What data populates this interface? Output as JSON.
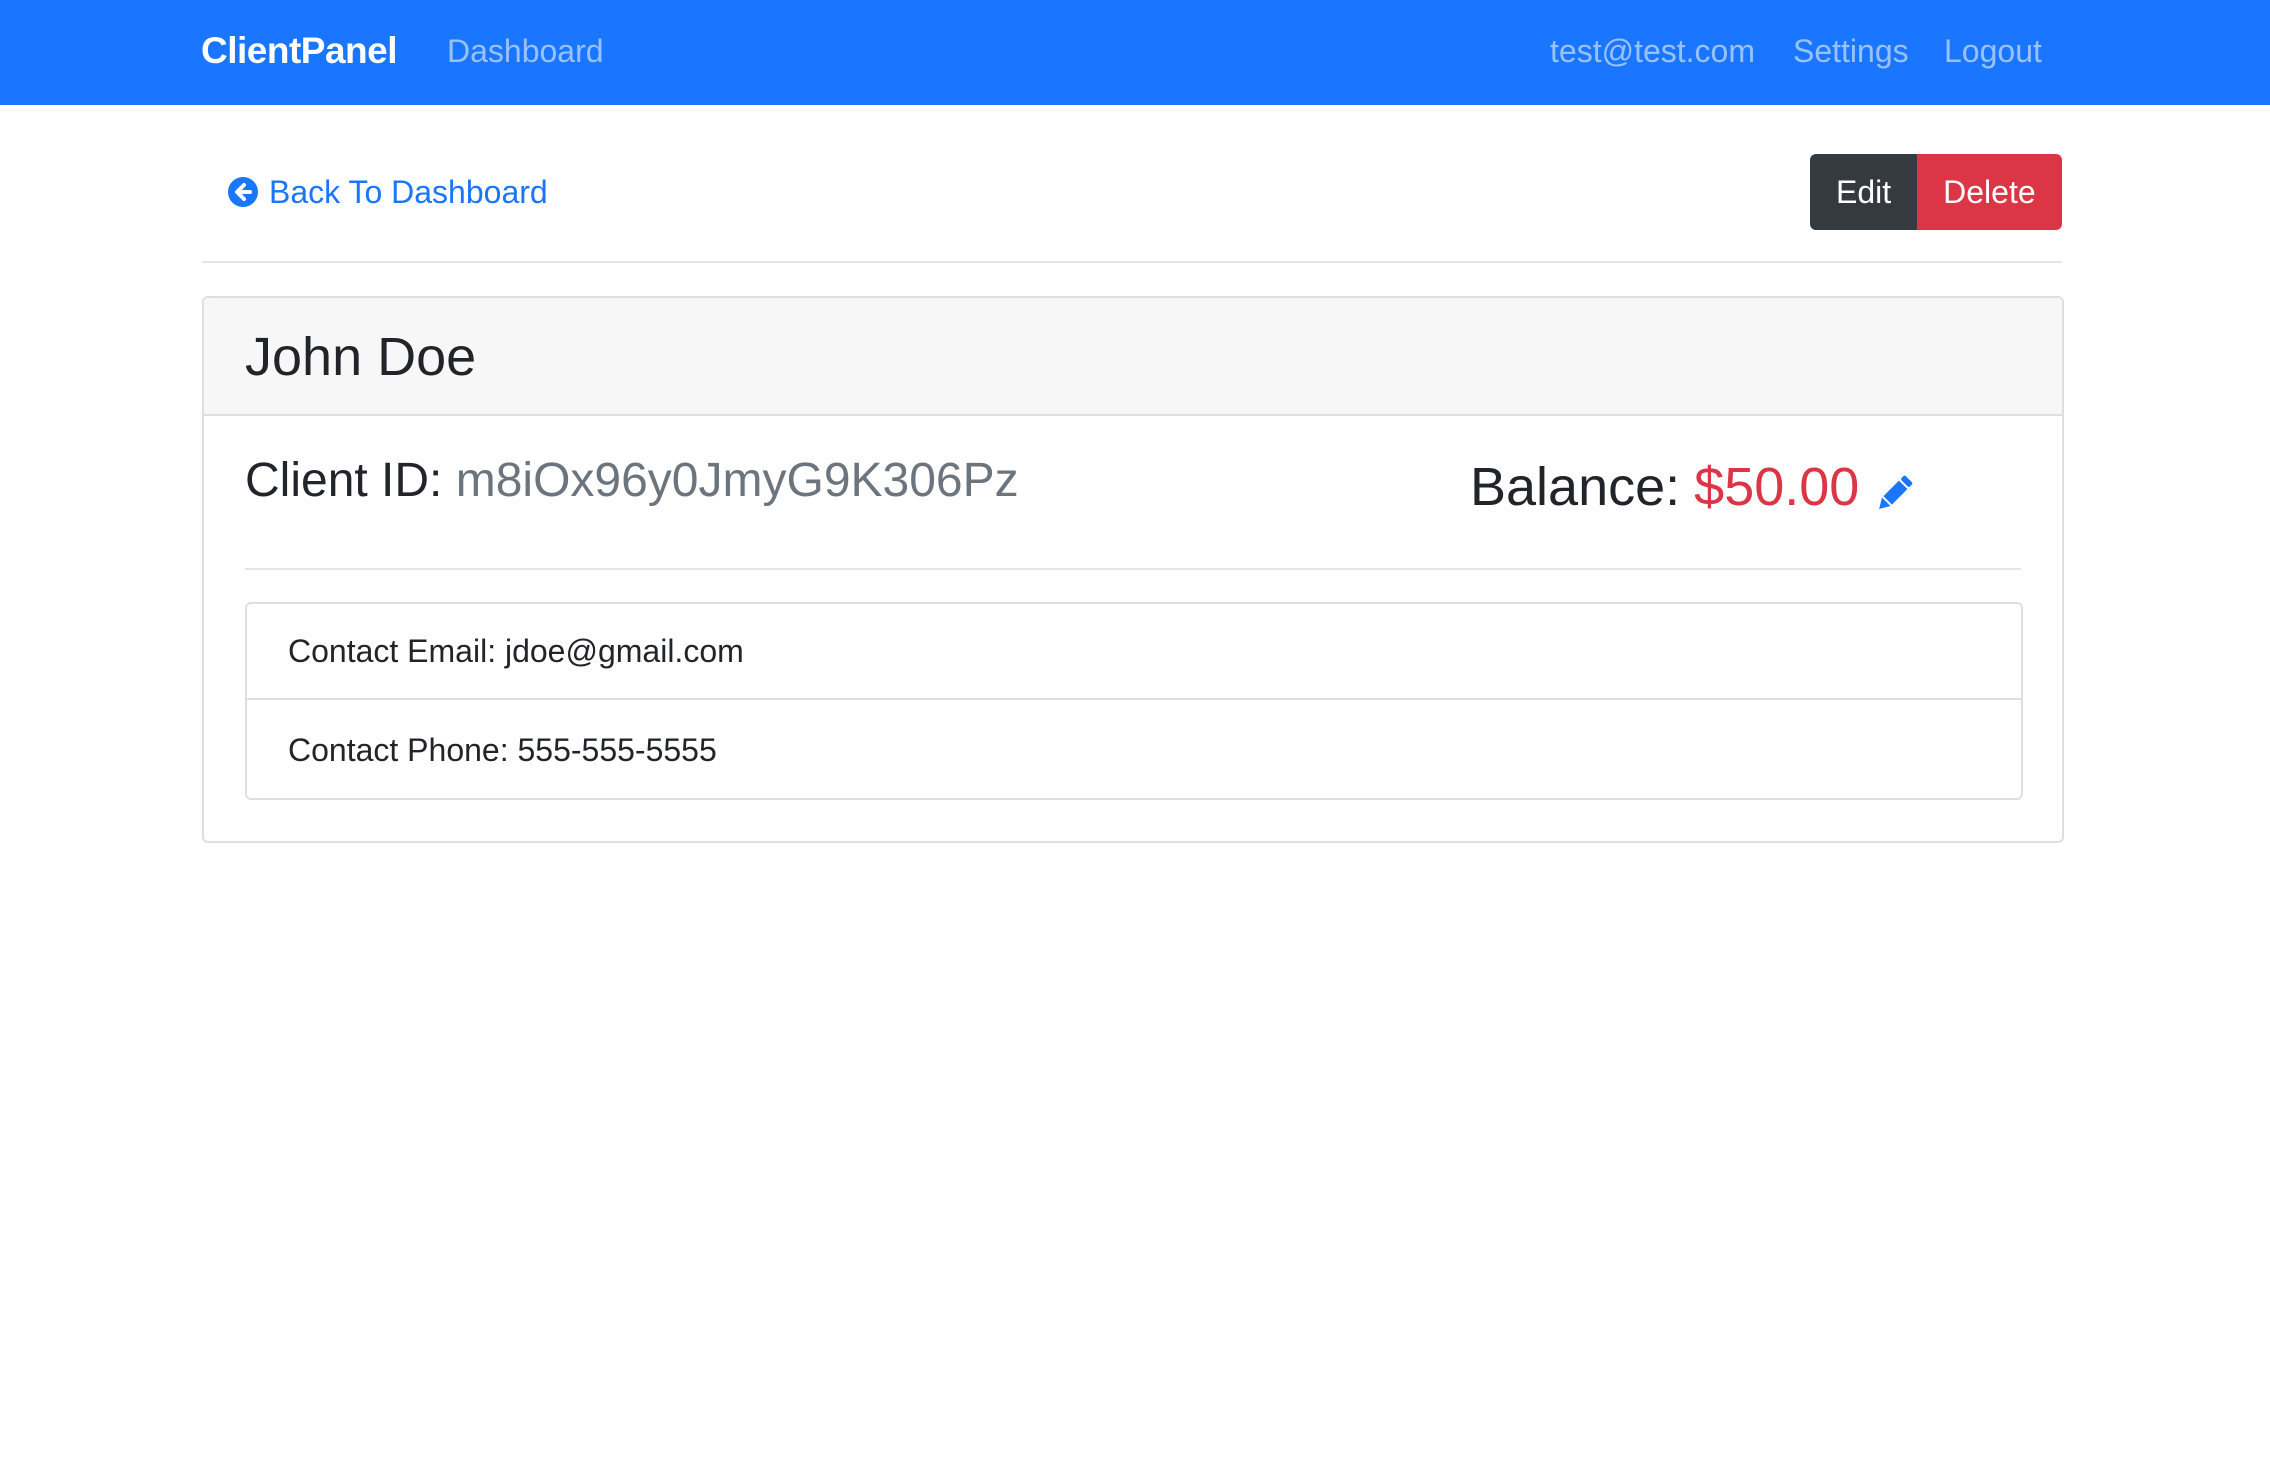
{
  "navbar": {
    "brand": "ClientPanel",
    "links": {
      "dashboard": "Dashboard",
      "user_email": "test@test.com",
      "settings": "Settings",
      "logout": "Logout"
    }
  },
  "toolbar": {
    "back_label": "Back To Dashboard",
    "edit_label": "Edit",
    "delete_label": "Delete"
  },
  "client": {
    "name": "John Doe",
    "id_label": "Client ID:",
    "id_value": "m8iOx96y0JmyG9K306Pz",
    "balance_label": "Balance:",
    "balance_value": "$50.00",
    "contact_email": "Contact Email: jdoe@gmail.com",
    "contact_phone": "Contact Phone: 555-555-5555"
  },
  "icons": {
    "back": "arrow-circle-left-icon",
    "edit_balance": "pencil-icon"
  },
  "colors": {
    "primary": "#1a76fe",
    "danger": "#dc3545",
    "dark": "#343a40",
    "muted": "#6c757d"
  }
}
